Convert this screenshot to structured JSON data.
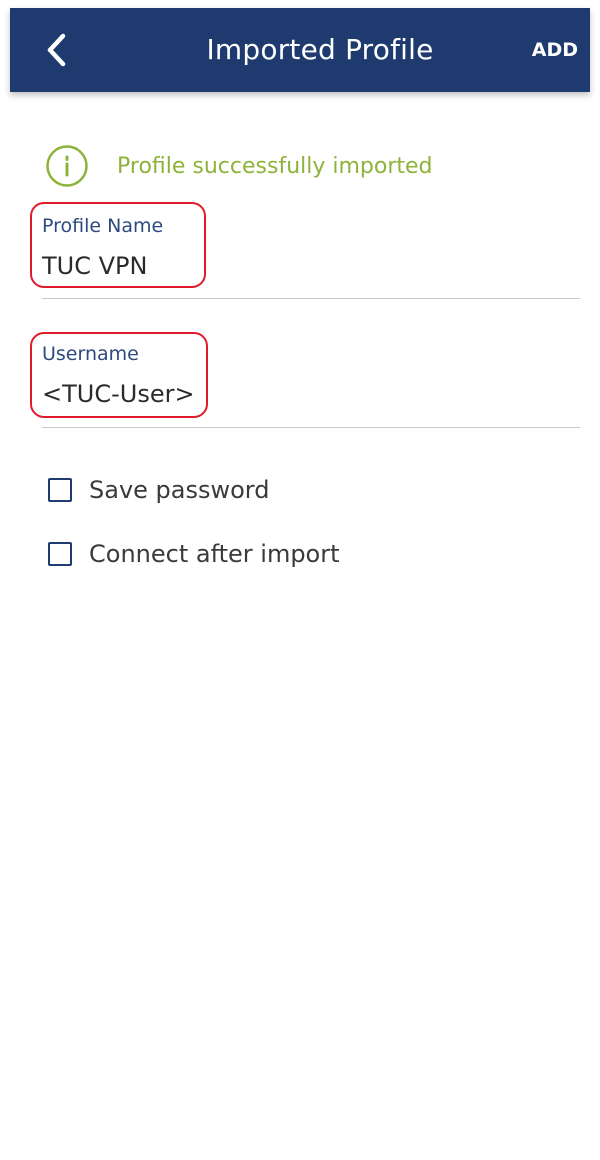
{
  "appbar": {
    "back_icon": "chevron-left-icon",
    "title": "Imported Profile",
    "add_label": "ADD",
    "background_color": "#1e3a6e"
  },
  "notice": {
    "icon": "info-icon",
    "text": "Profile successfully imported",
    "color": "#8db33a"
  },
  "form": {
    "profile_name": {
      "label": "Profile Name",
      "value": "TUC VPN"
    },
    "username": {
      "label": "Username",
      "value": "<TUC-User>"
    },
    "highlight_color": "#e21b2c"
  },
  "options": [
    {
      "label": "Save password",
      "checked": false
    },
    {
      "label": "Connect after import",
      "checked": false
    }
  ]
}
